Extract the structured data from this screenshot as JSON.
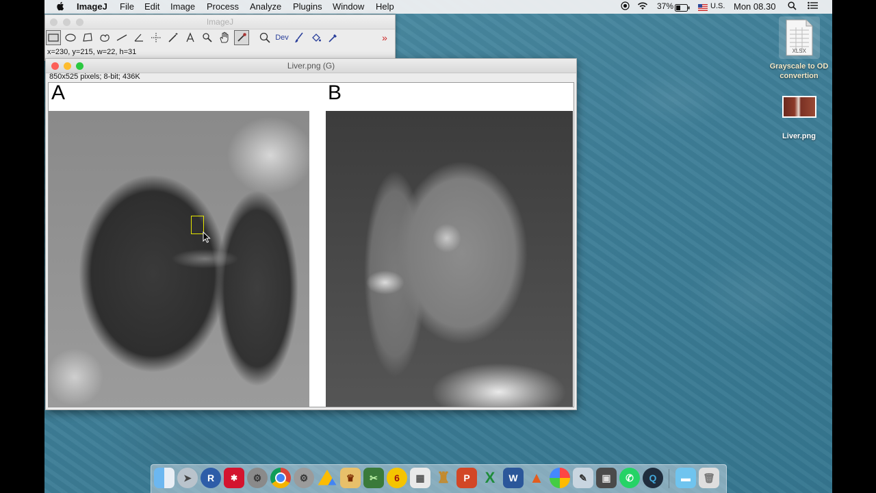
{
  "menubar": {
    "app_name": "ImageJ",
    "menus": [
      "File",
      "Edit",
      "Image",
      "Process",
      "Analyze",
      "Plugins",
      "Window",
      "Help"
    ],
    "battery": "37%",
    "input_source": "U.S.",
    "clock": "Mon 08.30"
  },
  "toolbar_window": {
    "title": "ImageJ",
    "dev_label": "Dev",
    "status": "x=230, y=215, w=22, h=31"
  },
  "image_window": {
    "title": "Liver.png (G)",
    "info": "850x525 pixels; 8-bit; 436K",
    "label_a": "A",
    "label_b": "B"
  },
  "desktop": {
    "icon1_badge": "XLSX",
    "icon1_label": "Grayscale to OD convertion",
    "icon2_label": "Liver.png"
  },
  "dock": {
    "r_label": "R",
    "six_label": "6"
  }
}
